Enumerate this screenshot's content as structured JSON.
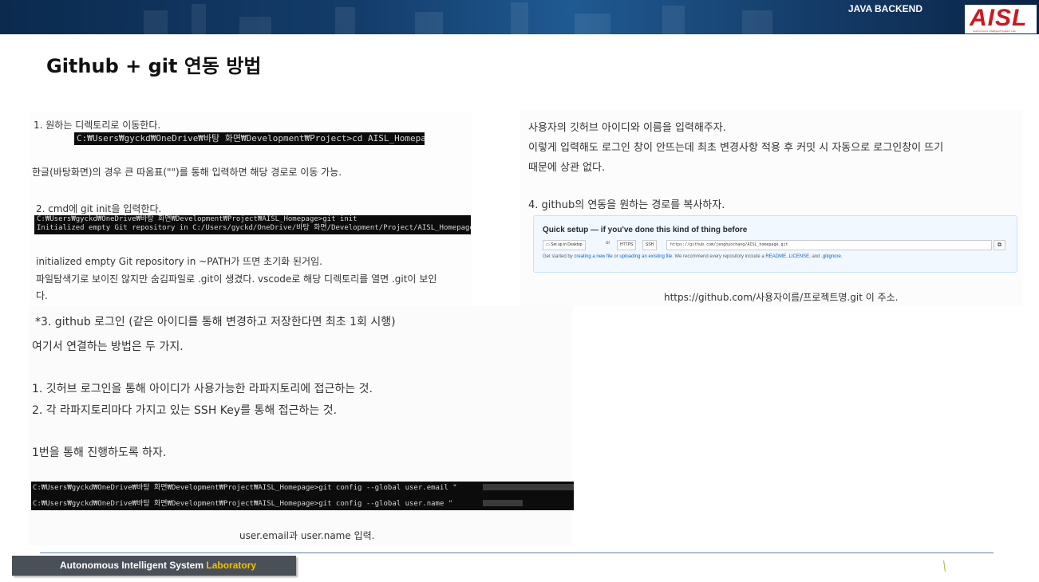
{
  "header": {
    "course_label": "JAVA BACKEND",
    "logo_text": "AISL",
    "logo_subtext": "Autonomous Intelligent System Lab.",
    "accent_color": "#d0161e"
  },
  "title": "Github + git 연동 방법",
  "left": {
    "step1": "1. 원하는 디렉토리로 이동한다.",
    "step1_cmd": "C:₩Users₩gyckd₩OneDrive₩바탕 화면₩Development₩Project>cd AISL_Homepage",
    "step1_note": "한글(바탕화면)의 경우 큰 따옴표(\"\")를 통해 입력하면 해당 경로로 이동 가능.",
    "step2": "2. cmd에 git init을 입력한다.",
    "step2_cmd_line1": "C:₩Users₩gyckd₩OneDrive₩바탕 화면₩Development₩Project₩AISL_Homepage>git init",
    "step2_cmd_line2": "Initialized empty Git repository in C:/Users/gyckd/OneDrive/바탕 화면/Development/Project/AISL_Homepage/.git/",
    "step2_note1": "initialized empty Git repository in ~PATH가 뜨면 초기화 된거임.",
    "step2_note2": "파일탐색기로 보이진 않지만 숨김파일로 .git이 생겼다. vscode로 해당 디렉토리를 열면 .git이 보인",
    "step2_note3": "다.",
    "step3": "*3. github 로그인 (같은 아이디를 통해 변경하고 저장한다면 최초 1회 시행)",
    "step3_intro": "여기서 연결하는 방법은 두 가지.",
    "method1": "1. 깃허브 로그인을 통해 아이디가 사용가능한 라파지토리에 접근하는 것.",
    "method2": "2. 각 라파지토리마다 가지고 있는 SSH Key를 통해 접근하는 것.",
    "choice": "1번을 통해 진행하도록 하자.",
    "config_cmd1": "C:₩Users₩gyckd₩OneDrive₩바탕 화면₩Development₩Project₩AISL_Homepage>git config --global user.email \"",
    "config_cmd2": "C:₩Users₩gyckd₩OneDrive₩바탕 화면₩Development₩Project₩AISL_Homepage>git config --global user.name \"",
    "config_caption": "user.email과 user.name 입력."
  },
  "right": {
    "line1": "사용자의 깃허브 아이디와 이름을 입력해주자.",
    "line2": "이렇게 입력해도 로그인 창이 안뜨는데 최초 변경사항 적용 후 커밋 시 자동으로 로그인창이 뜨기",
    "line3": "때문에 상관 없다.",
    "step4": "4. github의 연동을 원하는 경로를 복사하자.",
    "quick_setup": {
      "title": "Quick setup — if you've done this kind of thing before",
      "desktop_button": "Set up in Desktop",
      "or": "or",
      "https_button": "HTTPS",
      "ssh_button": "SSH",
      "url": "https://github.com/jenghyochang/AISL_homepage.git",
      "copy_icon": "⧉",
      "help_prefix": "Get started by",
      "help_link1": "creating a new file",
      "help_mid": "or",
      "help_link2": "uploading an existing file",
      "help_rest": ". We recommend every repository include a",
      "help_link3": "README",
      "help_link4": "LICENSE",
      "help_and": ", and",
      "help_link5": ".gitignore"
    },
    "caption": "https://github.com/사용자이름/프로젝트명.git 이 주소."
  },
  "footer": {
    "lab_name": "Autonomous Intelligent System",
    "lab_accent": "Laboratory"
  }
}
